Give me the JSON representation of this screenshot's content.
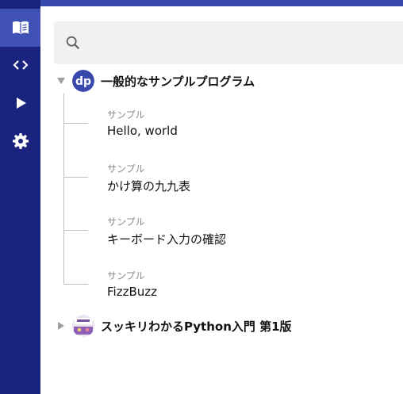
{
  "sidebar": {
    "items": [
      {
        "icon": "book-icon",
        "active": true
      },
      {
        "icon": "code-icon",
        "active": false
      },
      {
        "icon": "play-icon",
        "active": false
      },
      {
        "icon": "gear-icon",
        "active": false
      }
    ]
  },
  "search": {
    "placeholder": "",
    "value": ""
  },
  "tree": {
    "book1": {
      "title": "一般的なサンプルプログラム",
      "logo_text": "dp",
      "expanded": true,
      "items": [
        {
          "category": "サンプル",
          "name": "Hello, world"
        },
        {
          "category": "サンプル",
          "name": "かけ算の九九表"
        },
        {
          "category": "サンプル",
          "name": "キーボード入力の確認"
        },
        {
          "category": "サンプル",
          "name": "FizzBuzz"
        }
      ]
    },
    "book2": {
      "title": "スッキリわかるPython入門 第1版",
      "expanded": false
    }
  },
  "colors": {
    "sidebar_bg": "#1a237e",
    "sidebar_active": "#3f51b5",
    "topbar": "#3949ab",
    "search_bg": "#f1f1f1"
  }
}
